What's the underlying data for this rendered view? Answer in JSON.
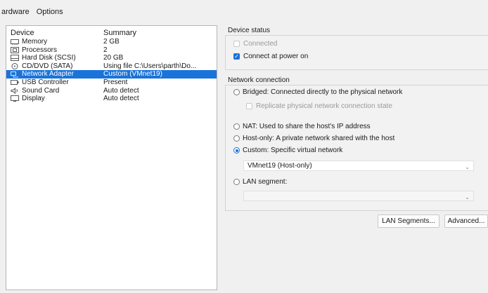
{
  "tabs": [
    {
      "label": "ardware",
      "active": true
    },
    {
      "label": "Options",
      "active": false
    }
  ],
  "device_list": {
    "columns": {
      "device": "Device",
      "summary": "Summary"
    },
    "rows": [
      {
        "icon": "memory-icon",
        "device": "Memory",
        "summary": "2 GB",
        "selected": false
      },
      {
        "icon": "processor-icon",
        "device": "Processors",
        "summary": "2",
        "selected": false
      },
      {
        "icon": "hard-disk-icon",
        "device": "Hard Disk (SCSI)",
        "summary": "20 GB",
        "selected": false
      },
      {
        "icon": "cd-dvd-icon",
        "device": "CD/DVD (SATA)",
        "summary": "Using file C:\\Users\\parth\\Do...",
        "selected": false
      },
      {
        "icon": "network-adapter-icon",
        "device": "Network Adapter",
        "summary": "Custom (VMnet19)",
        "selected": true
      },
      {
        "icon": "usb-controller-icon",
        "device": "USB Controller",
        "summary": "Present",
        "selected": false
      },
      {
        "icon": "sound-card-icon",
        "device": "Sound Card",
        "summary": "Auto detect",
        "selected": false
      },
      {
        "icon": "display-icon",
        "device": "Display",
        "summary": "Auto detect",
        "selected": false
      }
    ]
  },
  "device_status": {
    "title": "Device status",
    "connected": {
      "label": "Connected",
      "checked": false,
      "disabled": true
    },
    "connect_at_power_on": {
      "label": "Connect at power on",
      "checked": true
    }
  },
  "network_connection": {
    "title": "Network connection",
    "bridged": {
      "label": "Bridged: Connected directly to the physical network",
      "checked": false
    },
    "replicate": {
      "label": "Replicate physical network connection state",
      "disabled": true
    },
    "nat": {
      "label": "NAT: Used to share the host's IP address",
      "checked": false
    },
    "host_only": {
      "label": "Host-only: A private network shared with the host",
      "checked": false
    },
    "custom": {
      "label": "Custom: Specific virtual network",
      "checked": true
    },
    "custom_value": "VMnet19 (Host-only)",
    "lan_segment": {
      "label": "LAN segment:",
      "checked": false
    },
    "lan_value": ""
  },
  "buttons": {
    "lan_segments": "LAN Segments...",
    "advanced": "Advanced..."
  },
  "colors": {
    "selection": "#1a73d9",
    "background": "#f0f0f0"
  }
}
